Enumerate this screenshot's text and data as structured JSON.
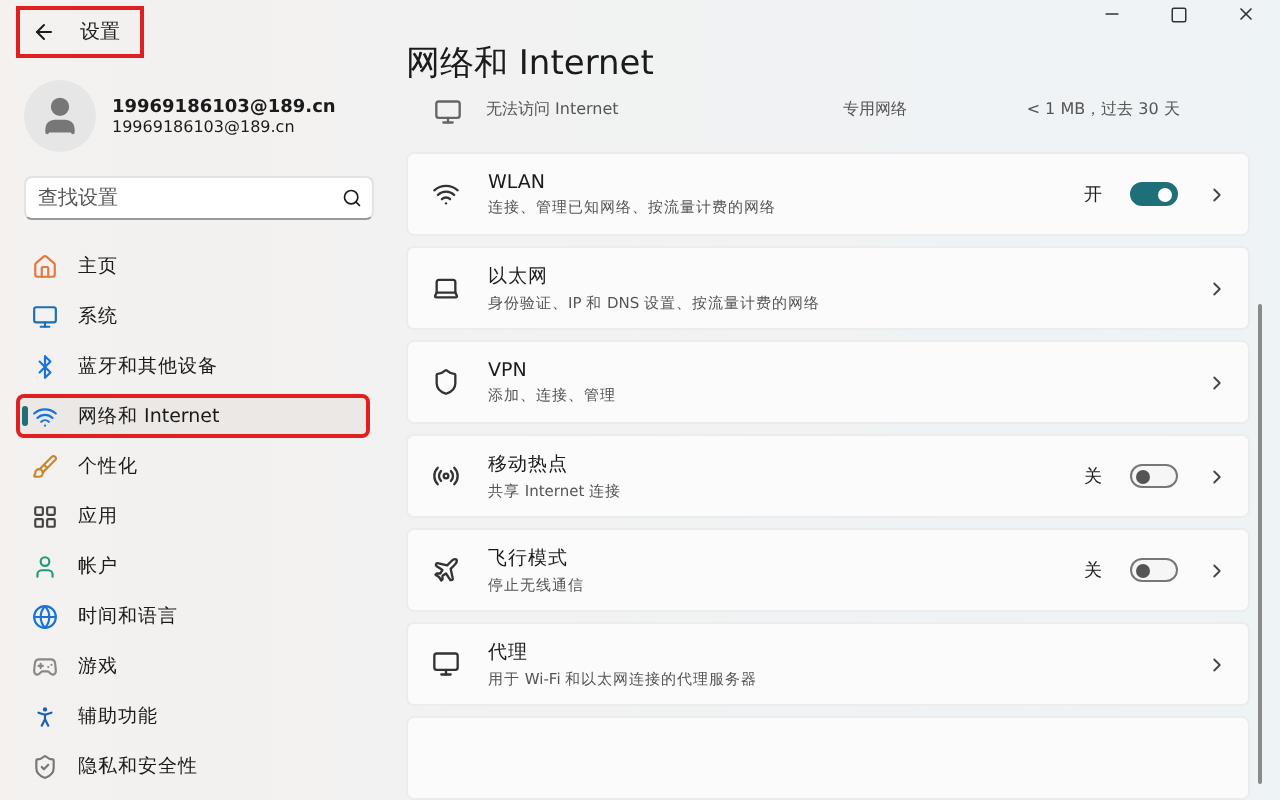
{
  "window": {
    "title": "设置",
    "back_highlighted": true
  },
  "account": {
    "name": "19969186103@189.cn",
    "email": "19969186103@189.cn"
  },
  "search": {
    "placeholder": "查找设置"
  },
  "sidebar": {
    "items": [
      {
        "label": "主页",
        "selected": false,
        "highlighted": false
      },
      {
        "label": "系统",
        "selected": false,
        "highlighted": false
      },
      {
        "label": "蓝牙和其他设备",
        "selected": false,
        "highlighted": false
      },
      {
        "label": "网络和 Internet",
        "selected": true,
        "highlighted": true
      },
      {
        "label": "个性化",
        "selected": false,
        "highlighted": false
      },
      {
        "label": "应用",
        "selected": false,
        "highlighted": false
      },
      {
        "label": "帐户",
        "selected": false,
        "highlighted": false
      },
      {
        "label": "时间和语言",
        "selected": false,
        "highlighted": false
      },
      {
        "label": "游戏",
        "selected": false,
        "highlighted": false
      },
      {
        "label": "辅助功能",
        "selected": false,
        "highlighted": false
      },
      {
        "label": "隐私和安全性",
        "selected": false,
        "highlighted": false
      }
    ]
  },
  "page": {
    "title": "网络和 Internet"
  },
  "network_status": {
    "subtitle": "无法访问 Internet",
    "network_type": "专用网络",
    "usage": "< 1 MB，过去 30 天"
  },
  "settings": [
    {
      "kind": "toggle",
      "title": "WLAN",
      "subtitle": "连接、管理已知网络、按流量计费的网络",
      "state": "开",
      "on": true
    },
    {
      "kind": "link",
      "title": "以太网",
      "subtitle": "身份验证、IP 和 DNS 设置、按流量计费的网络"
    },
    {
      "kind": "link",
      "title": "VPN",
      "subtitle": "添加、连接、管理"
    },
    {
      "kind": "toggle",
      "title": "移动热点",
      "subtitle": "共享 Internet 连接",
      "state": "关",
      "on": false
    },
    {
      "kind": "toggle",
      "title": "飞行模式",
      "subtitle": "停止无线通信",
      "state": "关",
      "on": false
    },
    {
      "kind": "link",
      "title": "代理",
      "subtitle": "用于 Wi-Fi 和以太网连接的代理服务器"
    }
  ]
}
